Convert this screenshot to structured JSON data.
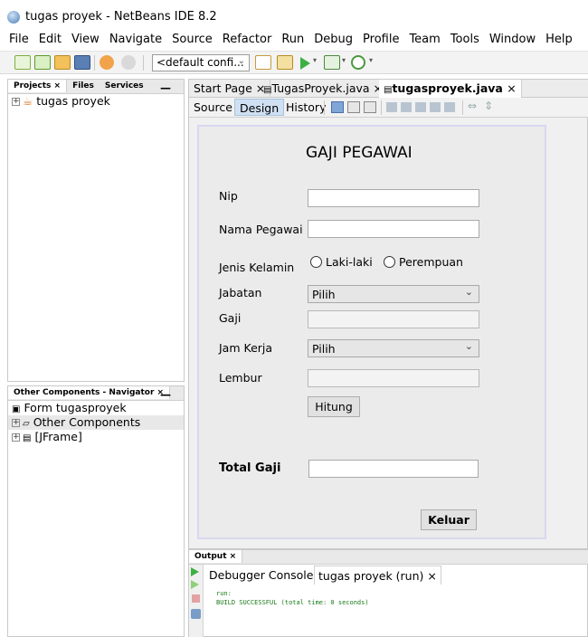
{
  "window": {
    "title": "tugas proyek - NetBeans IDE 8.2"
  },
  "menu": [
    "File",
    "Edit",
    "View",
    "Navigate",
    "Source",
    "Refactor",
    "Run",
    "Debug",
    "Profile",
    "Team",
    "Tools",
    "Window",
    "Help"
  ],
  "toolbar": {
    "config_value": "<default confi..."
  },
  "projects_panel": {
    "tabs": [
      "Projects ×",
      "Files",
      "Services"
    ],
    "tree": [
      {
        "label": "tugas proyek"
      }
    ]
  },
  "navigator_panel": {
    "title": "Other Components - Navigator ×",
    "tree": [
      "Form tugasproyek",
      "Other Components",
      "[JFrame]"
    ]
  },
  "editor": {
    "tabs": [
      "Start Page",
      "TugasProyek.java",
      "tugasproyek.java"
    ],
    "active_tab": "tugasproyek.java",
    "views": [
      "Source",
      "Design",
      "History"
    ],
    "active_view": "Design"
  },
  "form": {
    "title": "GAJI PEGAWAI",
    "nip_label": "Nip",
    "nama_label": "Nama Pegawai",
    "jk_label": "Jenis Kelamin",
    "radio_laki": "Laki-laki",
    "radio_perempuan": "Perempuan",
    "jabatan_label": "Jabatan",
    "jabatan_value": "Pilih",
    "gaji_label": "Gaji",
    "jam_label": "Jam Kerja",
    "jam_value": "Pilih",
    "lembur_label": "Lembur",
    "hitung_button": "Hitung",
    "total_label": "Total Gaji",
    "keluar_button": "Keluar"
  },
  "output": {
    "title": "Output ×",
    "tabs": [
      "Debugger Console ×",
      "tugas proyek (run) ×"
    ],
    "lines": [
      "run:",
      "BUILD SUCCESSFUL (total time: 0 seconds)"
    ]
  },
  "colors": {
    "accent": "#cfe0f2",
    "build_success": "#1a7a1a",
    "run_green": "#3cb043"
  }
}
